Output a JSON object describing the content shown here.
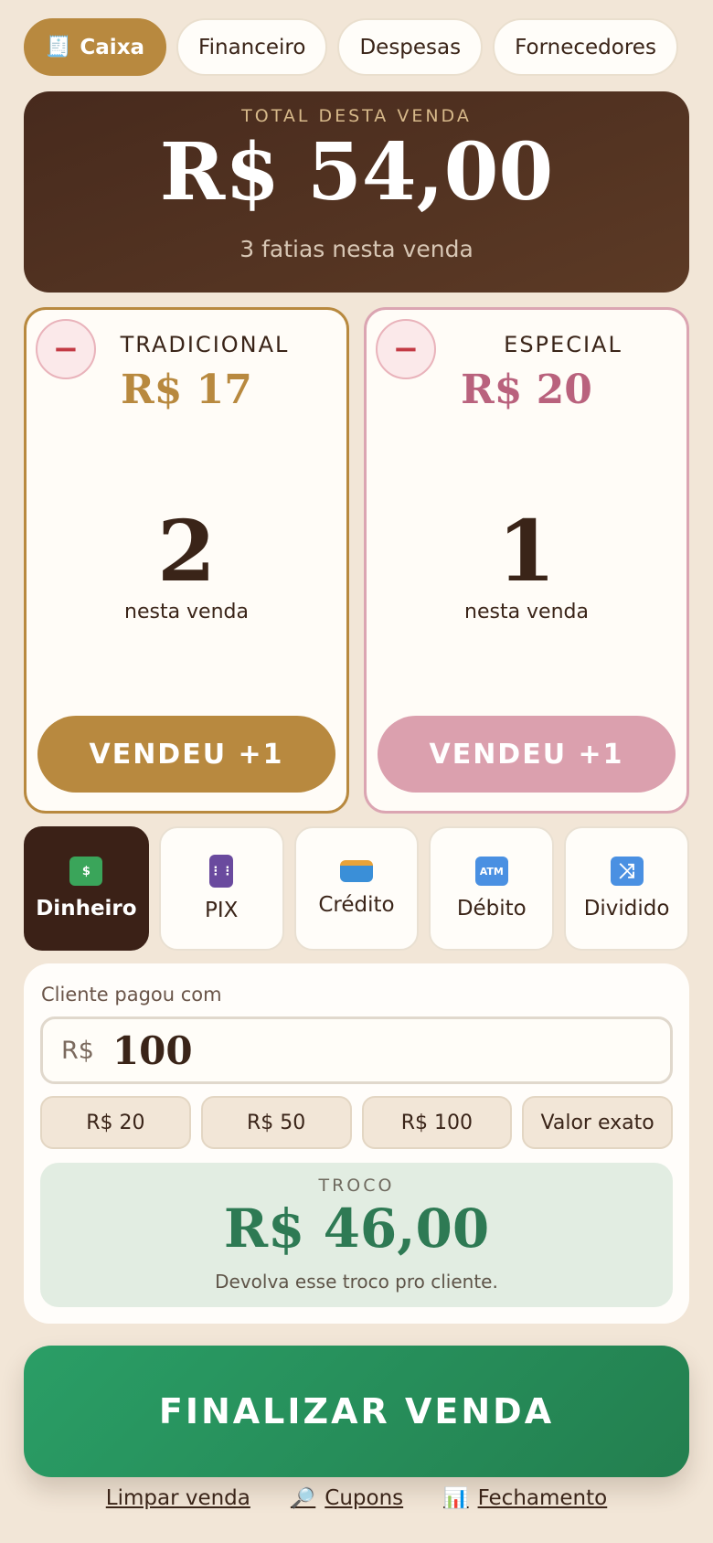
{
  "tabs": [
    {
      "label": "Caixa",
      "icon": "receipt-icon",
      "active": true
    },
    {
      "label": "Financeiro"
    },
    {
      "label": "Despesas"
    },
    {
      "label": "Fornecedores"
    }
  ],
  "total": {
    "label": "TOTAL DESTA VENDA",
    "value": "R$ 54,00",
    "subtitle": "3 fatias nesta venda"
  },
  "products": [
    {
      "name": "TRADICIONAL",
      "price": "R$ 17",
      "count": "2",
      "caption": "nesta venda",
      "sell_label": "VENDEU +1",
      "minus": "−",
      "color": "#b8893f"
    },
    {
      "name": "ESPECIAL",
      "price": "R$ 20",
      "count": "1",
      "caption": "nesta venda",
      "sell_label": "VENDEU +1",
      "minus": "−",
      "color": "#b9627d"
    }
  ],
  "payment_methods": [
    {
      "label": "Dinheiro",
      "icon": "cash-icon",
      "active": true
    },
    {
      "label": "PIX",
      "icon": "phone-icon"
    },
    {
      "label": "Crédito",
      "icon": "credit-card-icon"
    },
    {
      "label": "Débito",
      "icon": "atm-icon",
      "icon_text": "ATM"
    },
    {
      "label": "Dividido",
      "icon": "shuffle-icon",
      "icon_text": "⤨"
    }
  ],
  "cash": {
    "label": "Cliente pagou com",
    "currency": "R$",
    "amount": "100",
    "quick": [
      "R$ 20",
      "R$ 50",
      "R$ 100",
      "Valor exato"
    ],
    "change_label": "TROCO",
    "change_value": "R$ 46,00",
    "change_note": "Devolva esse troco pro cliente."
  },
  "finalize_label": "FINALIZAR VENDA",
  "footer": [
    {
      "label": "Limpar venda"
    },
    {
      "label": "Cupons",
      "icon": "magnifier-icon",
      "glyph": "🔎"
    },
    {
      "label": "Fechamento",
      "icon": "bar-chart-icon",
      "glyph": "📊"
    }
  ],
  "colors": {
    "accent": "#b8893f",
    "pink": "#dba0ae",
    "dark": "#3b2117",
    "green": "#2a9e66"
  }
}
